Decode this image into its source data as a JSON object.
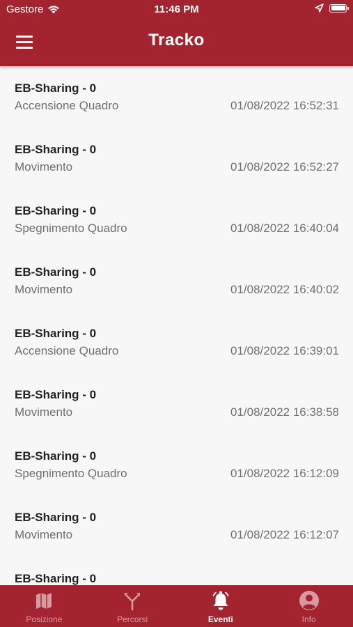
{
  "status_bar": {
    "carrier": "Gestore",
    "time": "11:46 PM"
  },
  "header": {
    "title": "Tracko"
  },
  "events": [
    {
      "device": "EB-Sharing - 0",
      "type": "Accensione Quadro",
      "datetime": "01/08/2022 16:52:31"
    },
    {
      "device": "EB-Sharing - 0",
      "type": "Movimento",
      "datetime": "01/08/2022 16:52:27"
    },
    {
      "device": "EB-Sharing - 0",
      "type": "Spegnimento Quadro",
      "datetime": "01/08/2022 16:40:04"
    },
    {
      "device": "EB-Sharing - 0",
      "type": "Movimento",
      "datetime": "01/08/2022 16:40:02"
    },
    {
      "device": "EB-Sharing - 0",
      "type": "Accensione Quadro",
      "datetime": "01/08/2022 16:39:01"
    },
    {
      "device": "EB-Sharing - 0",
      "type": "Movimento",
      "datetime": "01/08/2022 16:38:58"
    },
    {
      "device": "EB-Sharing - 0",
      "type": "Spegnimento Quadro",
      "datetime": "01/08/2022 16:12:09"
    },
    {
      "device": "EB-Sharing - 0",
      "type": "Movimento",
      "datetime": "01/08/2022 16:12:07"
    },
    {
      "device": "EB-Sharing - 0",
      "type": "",
      "datetime": ""
    }
  ],
  "tab_bar": {
    "active": "eventi",
    "tabs": [
      {
        "label": "Posizione",
        "icon": "map-icon"
      },
      {
        "label": "Percorsi",
        "icon": "route-split-icon"
      },
      {
        "label": "Eventi",
        "icon": "bell-icon"
      },
      {
        "label": "Info",
        "icon": "user-icon"
      }
    ]
  },
  "colors": {
    "brand": "#a3242f",
    "tab_inactive": "#d79aa1",
    "tab_active": "#ffffff",
    "background": "#f7f7f7",
    "secondary_text": "#6f6f6f"
  }
}
